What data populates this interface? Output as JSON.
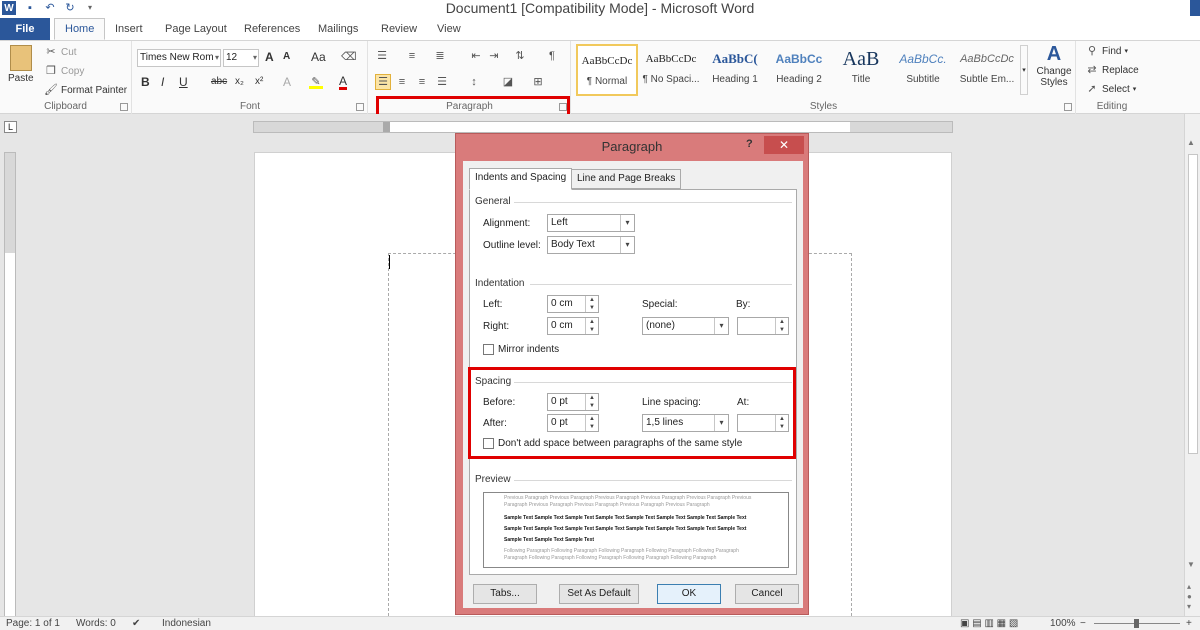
{
  "window": {
    "title": "Document1 [Compatibility Mode]  -  Microsoft Word",
    "logo_letter": "W"
  },
  "tabs": [
    "File",
    "Home",
    "Insert",
    "Page Layout",
    "References",
    "Mailings",
    "Review",
    "View"
  ],
  "ribbon": {
    "clipboard": {
      "label": "Clipboard",
      "paste": "Paste",
      "cut": "Cut",
      "copy": "Copy",
      "format_painter": "Format Painter"
    },
    "font": {
      "label": "Font",
      "name": "Times New Rom",
      "size": "12",
      "bold": "B",
      "italic": "I",
      "strike": "abc",
      "subscript": "x₂",
      "superscript": "x²",
      "grow": "A",
      "shrink": "A",
      "case": "Aa",
      "color_a": "A"
    },
    "paragraph": {
      "label": "Paragraph"
    },
    "styles": {
      "label": "Styles",
      "items": [
        {
          "preview": "AaBbCcDc",
          "name": "¶ Normal"
        },
        {
          "preview": "AaBbCcDc",
          "name": "¶ No Spaci..."
        },
        {
          "preview": "AaBbC(",
          "name": "Heading 1"
        },
        {
          "preview": "AaBbCc",
          "name": "Heading 2"
        },
        {
          "preview": "AaB",
          "name": "Title"
        },
        {
          "preview": "AaBbCc.",
          "name": "Subtitle"
        },
        {
          "preview": "AaBbCcDc",
          "name": "Subtle Em..."
        }
      ],
      "change_styles": "Change Styles"
    },
    "editing": {
      "label": "Editing",
      "find": "Find",
      "replace": "Replace",
      "select": "Select"
    }
  },
  "dialog": {
    "title": "Paragraph",
    "help": "?",
    "tabs": [
      "Indents and Spacing",
      "Line and Page Breaks"
    ],
    "general": {
      "title": "General",
      "alignment_label": "Alignment:",
      "alignment_value": "Left",
      "outline_label": "Outline level:",
      "outline_value": "Body Text"
    },
    "indentation": {
      "title": "Indentation",
      "left_label": "Left:",
      "left_value": "0 cm",
      "right_label": "Right:",
      "right_value": "0 cm",
      "special_label": "Special:",
      "special_value": "(none)",
      "by_label": "By:",
      "by_value": "",
      "mirror_label": "Mirror indents"
    },
    "spacing": {
      "title": "Spacing",
      "before_label": "Before:",
      "before_value": "0 pt",
      "after_label": "After:",
      "after_value": "0 pt",
      "line_label": "Line spacing:",
      "line_value": "1,5 lines",
      "at_label": "At:",
      "at_value": "",
      "dont_add_label": "Don't add space between paragraphs of the same style"
    },
    "preview": {
      "title": "Preview",
      "prev1": "Previous Paragraph Previous Paragraph Previous Paragraph Previous Paragraph Previous Paragraph Previous",
      "prev2": "Paragraph Previous Paragraph Previous Paragraph Previous Paragraph Previous Paragraph",
      "sample1": "Sample Text Sample Text Sample Text Sample Text Sample Text Sample Text Sample Text Sample Text",
      "sample2": "Sample Text Sample Text Sample Text Sample Text Sample Text Sample Text Sample Text Sample Text",
      "sample3": "Sample Text Sample Text Sample Text",
      "follow1": "Following Paragraph Following Paragraph Following Paragraph Following Paragraph Following Paragraph",
      "follow2": "Paragraph Following Paragraph Following Paragraph Following Paragraph Following Paragraph"
    },
    "buttons": {
      "tabs": "Tabs...",
      "set_default": "Set As Default",
      "ok": "OK",
      "cancel": "Cancel"
    }
  },
  "statusbar": {
    "page": "Page: 1 of 1",
    "words": "Words: 0",
    "language": "Indonesian",
    "zoom": "100%"
  },
  "colors": {
    "accent": "#2b579a",
    "dialog_frame": "#d97b7b",
    "highlight": "#e00000"
  }
}
